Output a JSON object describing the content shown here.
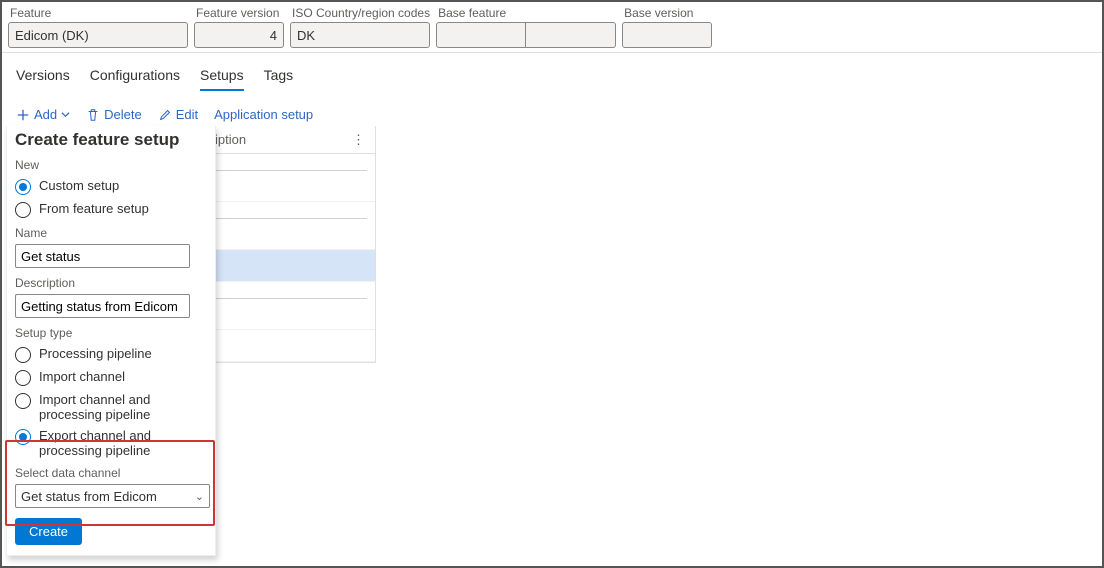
{
  "top": {
    "feature_label": "Feature",
    "feature": "Edicom (DK)",
    "version_label": "Feature version",
    "version": "4",
    "iso_label": "ISO Country/region codes",
    "iso": "DK",
    "base_label": "Base feature",
    "base1": "",
    "base2": "",
    "basev_label": "Base version",
    "basev": ""
  },
  "tabs": {
    "versions": "Versions",
    "configurations": "Configurations",
    "setups": "Setups",
    "tags": "Tags"
  },
  "toolbar": {
    "add": "Add",
    "delete": "Delete",
    "edit": "Edit",
    "appsetup": "Application setup"
  },
  "table": {
    "col": "iption"
  },
  "panel": {
    "title": "Create feature setup",
    "new_label": "New",
    "opt_custom": "Custom setup",
    "opt_from": "From feature setup",
    "name_label": "Name",
    "name": "Get status",
    "desc_label": "Description",
    "desc": "Getting status from Edicom",
    "type_label": "Setup type",
    "opt_proc": "Processing pipeline",
    "opt_import": "Import channel",
    "opt_import_pipe": "Import channel and processing pipeline",
    "opt_export_pipe": "Export channel and processing pipeline",
    "channel_label": "Select data channel",
    "channel_value": "Get status from Edicom",
    "create": "Create"
  }
}
